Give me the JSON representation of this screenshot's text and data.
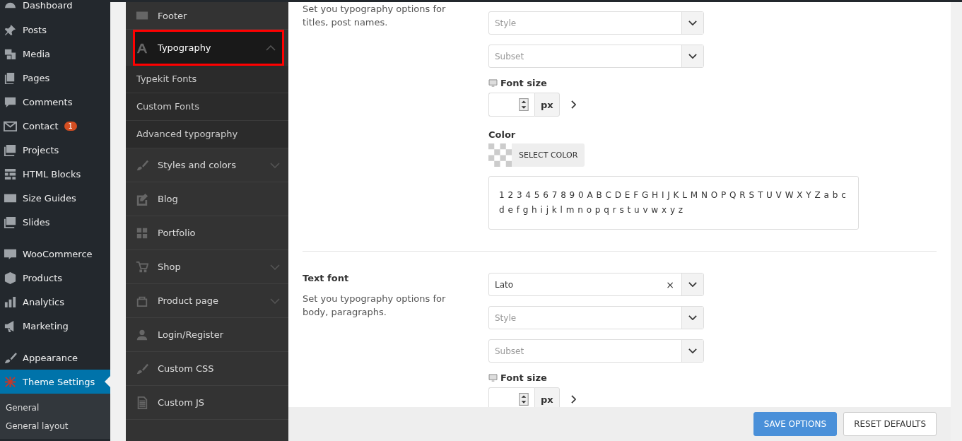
{
  "admin_menu": {
    "groups": [
      {
        "items": [
          {
            "label": "Dashboard",
            "selected": false
          }
        ]
      },
      {
        "items": [
          {
            "label": "Posts",
            "selected": false
          },
          {
            "label": "Media",
            "selected": false
          },
          {
            "label": "Pages",
            "selected": false
          },
          {
            "label": "Comments",
            "selected": false
          },
          {
            "label": "Contact",
            "selected": false,
            "badge": "1"
          },
          {
            "label": "Projects",
            "selected": false
          },
          {
            "label": "HTML Blocks",
            "selected": false
          },
          {
            "label": "Size Guides",
            "selected": false
          },
          {
            "label": "Slides",
            "selected": false
          }
        ]
      },
      {
        "items": [
          {
            "label": "WooCommerce",
            "selected": false
          },
          {
            "label": "Products",
            "selected": false
          },
          {
            "label": "Analytics",
            "selected": false
          },
          {
            "label": "Marketing",
            "selected": false
          }
        ]
      },
      {
        "items": [
          {
            "label": "Appearance",
            "selected": false
          },
          {
            "label": "Theme Settings",
            "selected": true,
            "children": [
              {
                "label": "General"
              },
              {
                "label": "General layout"
              }
            ]
          }
        ]
      }
    ]
  },
  "theme_menu": {
    "items": [
      {
        "label": "Footer",
        "selected": false,
        "highlighted": false
      },
      {
        "label": "Typography",
        "selected": true,
        "expanded": true,
        "highlighted": true,
        "children": [
          {
            "label": "Typekit Fonts"
          },
          {
            "label": "Custom Fonts"
          },
          {
            "label": "Advanced typography"
          }
        ]
      },
      {
        "label": "Styles and colors",
        "selected": false,
        "expanded": false,
        "highlighted": false
      },
      {
        "label": "Blog",
        "selected": false,
        "highlighted": false
      },
      {
        "label": "Portfolio",
        "selected": false,
        "highlighted": false
      },
      {
        "label": "Shop",
        "selected": false,
        "expanded": false,
        "highlighted": false
      },
      {
        "label": "Product page",
        "selected": false,
        "expanded": false,
        "highlighted": false
      },
      {
        "label": "Login/Register",
        "selected": false,
        "highlighted": false
      },
      {
        "label": "Custom CSS",
        "selected": false,
        "highlighted": false
      },
      {
        "label": "Custom JS",
        "selected": false,
        "highlighted": false
      }
    ]
  },
  "sections": [
    {
      "description": "Set you typography options for titles, post names.",
      "style_placeholder": "Style",
      "subset_placeholder": "Subset",
      "font_size_label": "Font size",
      "unit": "px",
      "color_label": "Color",
      "color_button": "SELECT COLOR",
      "preview": "1 2 3 4 5 6 7 8 9 0 A B C D E F G H I J K L M N O P Q R S T U V W X Y Z a b c d e f g h i j k l m n o p q r s t u v w x y z"
    },
    {
      "title": "Text font",
      "description": "Set you typography options for body, paragraphs.",
      "font_value": "Lato",
      "clear": "×",
      "style_placeholder": "Style",
      "subset_placeholder": "Subset",
      "font_size_label": "Font size",
      "unit": "px"
    }
  ],
  "footer": {
    "buttons": [
      {
        "label": "SAVE OPTIONS",
        "kind": "primary"
      },
      {
        "label": "RESET DEFAULTS",
        "kind": "secondary"
      }
    ]
  }
}
